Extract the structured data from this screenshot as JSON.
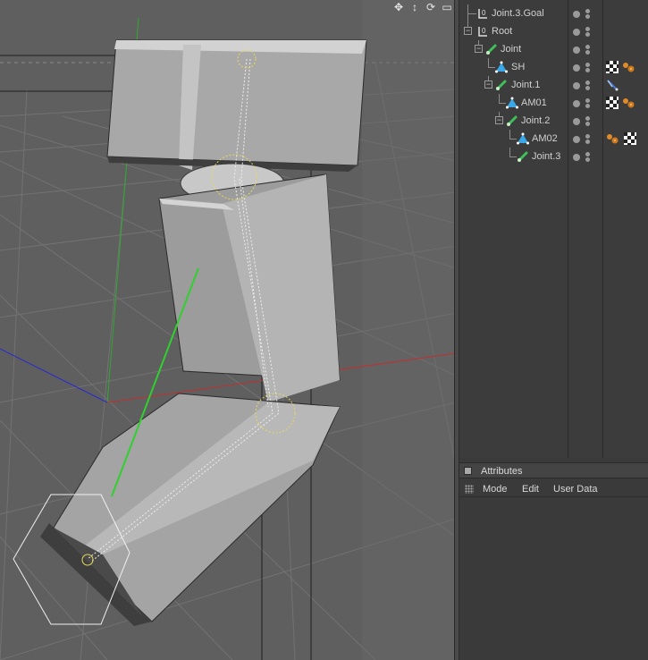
{
  "viewport": {
    "icons": [
      "move-icon",
      "dolly-icon",
      "rotate-icon",
      "maximize-icon"
    ],
    "icon_glyphs": [
      "✥",
      "↕",
      "⟳",
      "▭"
    ],
    "colors": {
      "background": "#5f5f5f",
      "grid": "#727272",
      "axis_x": "#c03030",
      "axis_y": "#2faa2f",
      "axis_z": "#2a2ad0",
      "mesh_light": "#bdbdbd",
      "mesh_dark": "#4a4a4a",
      "joint_handle": "#e8d85a"
    }
  },
  "object_manager": {
    "items": [
      {
        "name": "Joint.3.Goal",
        "icon": "null-object-icon",
        "tags": []
      },
      {
        "name": "Root",
        "icon": "null-object-icon",
        "tags": []
      },
      {
        "name": "Joint",
        "icon": "joint-icon",
        "tags": []
      },
      {
        "name": "SH",
        "icon": "polygon-object-icon",
        "tags": [
          "texture-tag-icon",
          "material-tag-icon"
        ]
      },
      {
        "name": "Joint.1",
        "icon": "joint-icon",
        "tags": [
          "ik-tag-icon"
        ]
      },
      {
        "name": "AM01",
        "icon": "polygon-object-icon",
        "tags": [
          "texture-tag-icon",
          "material-tag-icon"
        ]
      },
      {
        "name": "Joint.2",
        "icon": "joint-icon",
        "tags": []
      },
      {
        "name": "AM02",
        "icon": "polygon-object-icon",
        "tags": [
          "material-tag-icon",
          "texture-tag-icon"
        ]
      },
      {
        "name": "Joint.3",
        "icon": "joint-icon",
        "tags": []
      }
    ]
  },
  "attributes": {
    "title": "Attributes",
    "menu": {
      "mode": "Mode",
      "edit": "Edit",
      "user_data": "User Data"
    }
  }
}
